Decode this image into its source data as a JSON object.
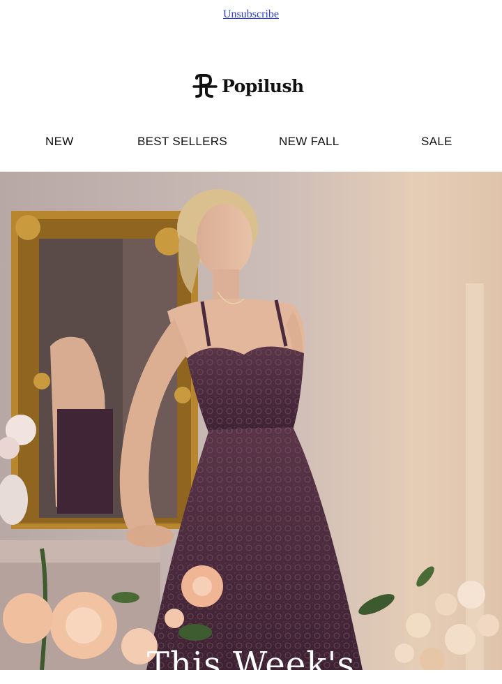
{
  "header": {
    "unsubscribe_label": "Unsubscribe"
  },
  "brand": {
    "name": "Popilush"
  },
  "nav": {
    "items": [
      {
        "label": "NEW"
      },
      {
        "label": "BEST SELLERS"
      },
      {
        "label": "NEW FALL"
      },
      {
        "label": "SALE"
      }
    ]
  },
  "hero": {
    "headline": "This Week's",
    "dress_color": "#4a2a3c",
    "frame_color": "#b8862e"
  }
}
